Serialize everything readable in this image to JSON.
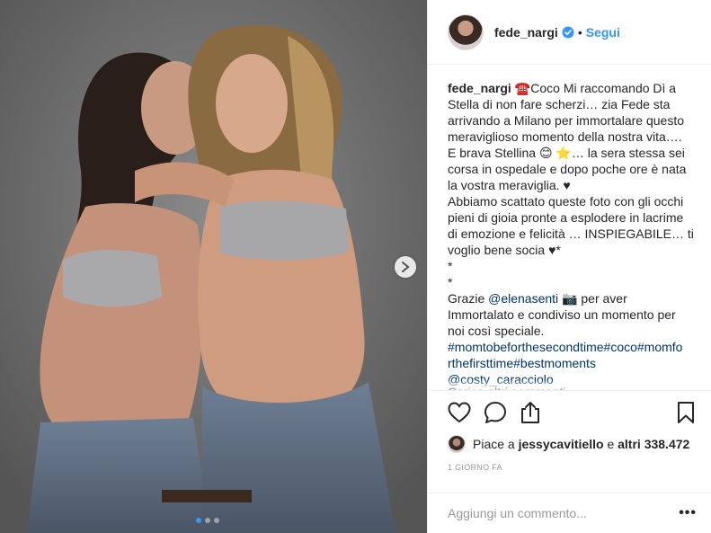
{
  "post": {
    "photo_description_icon": "photo-icon",
    "carousel_total": 3,
    "carousel_active": 0
  },
  "header": {
    "username": "fede_nargi",
    "separator": "•",
    "follow_label": "Segui",
    "verified_icon": "verified-badge-icon",
    "accent_color": "#3897f0"
  },
  "caption": {
    "username": "fede_nargi",
    "lines": [
      "☎️Coco Mi raccomando Dì a",
      "Stella di non fare scherzi… zia Fede sta",
      "arrivando a Milano per immortalare questo",
      "meraviglioso momento della nostra vita….",
      "E brava Stellina 😊 ⭐… la sera stessa sei",
      "corsa in ospedale e dopo poche ore è nata",
      "la vostra meraviglia. ♥",
      "Abbiamo scattato queste foto con gli occhi",
      "pieni di gioia pronte a esplodere in lacrime",
      "di emozione e felicità … INSPIEGABILE… ti",
      "voglio bene socia ♥*",
      "*",
      "*"
    ],
    "thanks_prefix": "Grazie ",
    "mention_photographer": "@elenasenti",
    "thanks_suffix": " 📷 per aver",
    "thanks_line2": "Immortalato e condiviso un momento per",
    "thanks_line3": "noi così speciale.",
    "hashtags_line1": "#momtobeforthesecondtime#coco#momfo",
    "hashtags_line2": "rthefirsttime#bestmoments",
    "mention_last": "@costy_caracciolo",
    "load_more": "Carica altri commenti"
  },
  "actions": {
    "like_icon": "heart-icon",
    "comment_icon": "comment-icon",
    "share_icon": "share-icon",
    "save_icon": "bookmark-icon"
  },
  "likes": {
    "prefix": "Piace a ",
    "user": "jessycavitiello",
    "middle": " e ",
    "others": "altri 338.472"
  },
  "timestamp": "1 GIORNO FA",
  "comment": {
    "placeholder": "Aggiungi un commento...",
    "more_label": "•••"
  }
}
